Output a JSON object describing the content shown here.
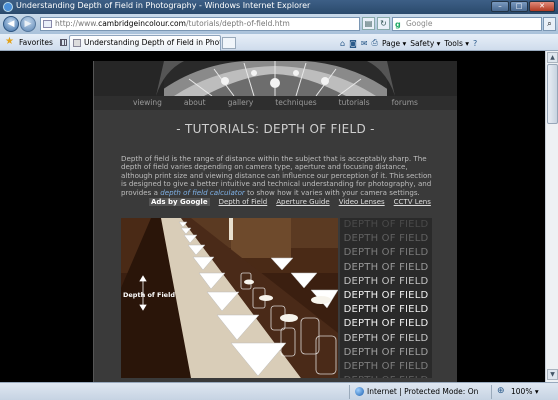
{
  "window": {
    "title": "Understanding Depth of Field in Photography - Windows Internet Explorer",
    "minimize": "–",
    "maximize": "□",
    "close": "✕"
  },
  "address_bar": {
    "url_prefix": "http://www.",
    "url_domain": "cambridgeincolour.com",
    "url_path": "/tutorials/depth-of-field.htm",
    "back_glyph": "◀",
    "forward_glyph": "▶",
    "refresh_glyph": "↻",
    "stop_glyph": "✕",
    "search_placeholder": "Google",
    "search_glyph": "⌕"
  },
  "favorites_bar": {
    "favorites_label": "Favorites",
    "tab_title": "Understanding Depth of Field in Photography",
    "commands": [
      "Page ▾",
      "Safety ▾",
      "Tools ▾"
    ]
  },
  "site": {
    "nav": [
      "viewing",
      "about",
      "gallery",
      "techniques",
      "tutorials",
      "forums"
    ],
    "heading": "- TUTORIALS: DEPTH OF FIELD -",
    "intro_text": "Depth of field is the range of distance within the subject that is acceptably sharp.  The depth of field varies depending on camera type, aperture and focusing distance, although print size and viewing distance can influence our perception of it.  This section is designed to give a better intuitive and technical understanding for photography, and provides a",
    "intro_link": "depth of field calculator",
    "intro_end": " to show how it varies with your camera settings.",
    "ads_label": "Ads by Google",
    "ad_links": [
      "Depth of Field",
      "Aperture Guide",
      "Video Lenses",
      "CCTV Lens"
    ],
    "photo_label": "Depth of Field",
    "dof_lines": [
      "DEPTH OF FIELD",
      "DEPTH OF FIELD",
      "DEPTH OF FIELD",
      "DEPTH OF FIELD",
      "DEPTH OF FIELD",
      "DEPTH OF FIELD",
      "DEPTH OF FIELD",
      "DEPTH OF FIELD",
      "DEPTH OF FIELD",
      "DEPTH OF FIELD",
      "DEPTH OF FIELD",
      "DEPTH OF FIELD"
    ],
    "dof_colors": [
      "#4a4a4a",
      "#606060",
      "#7a7a7a",
      "#9a9a9a",
      "#c4c4c4",
      "#f2f2f2",
      "#f2f2f2",
      "#f2f2f2",
      "#c8c8c8",
      "#a0a0a0",
      "#7e7e7e",
      "#5e5e5e"
    ]
  },
  "status_bar": {
    "zone": "Internet | Protected Mode: On",
    "zoom": "100%",
    "zoom_dropdown": "▾"
  }
}
